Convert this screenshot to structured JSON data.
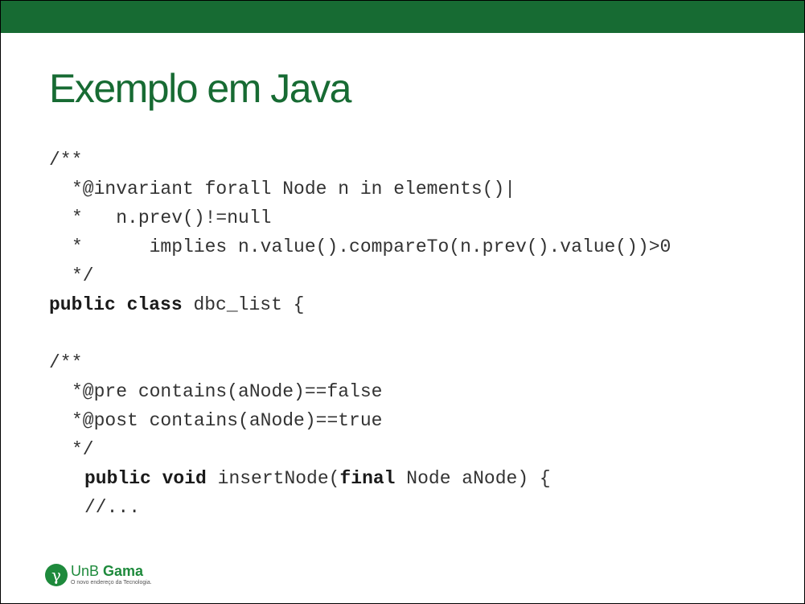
{
  "slide": {
    "title": "Exemplo em Java",
    "code_lines": [
      "/**",
      "*@invariant forall Node n in elements()|",
      "*   n.prev()!=null",
      "*      implies n.value().compareTo(n.prev().value())>0",
      "*/",
      "public class",
      "dbc_list {",
      "",
      "/**",
      "*@pre contains(aNode)==false",
      "*@post contains(aNode)==true",
      "*/",
      "public void",
      "insertNode(",
      "final",
      "Node aNode) {",
      "//..."
    ]
  },
  "logo": {
    "symbol": "γ",
    "name_part1": "UnB",
    "name_part2": "Gama",
    "tagline": "O novo endereço da Tecnologia."
  },
  "colors": {
    "brand_green": "#176B33",
    "logo_green": "#1E8A3C",
    "code_text": "#333333"
  }
}
